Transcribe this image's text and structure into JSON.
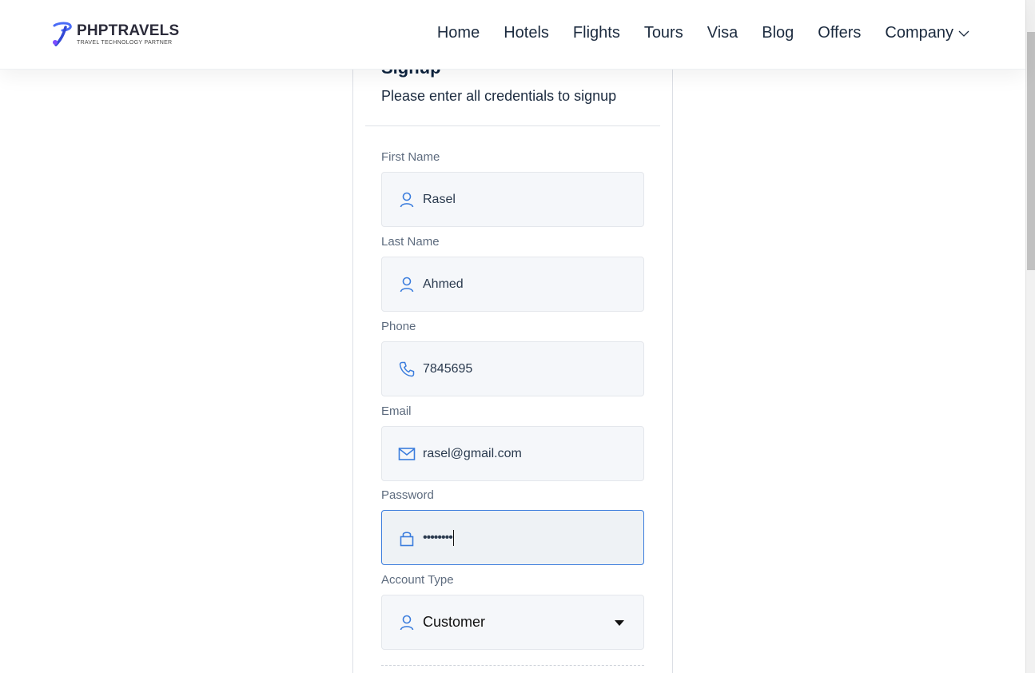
{
  "brand": {
    "name": "PHPTRAVELS",
    "tagline": "TRAVEL TECHNOLOGY PARTNER",
    "accent": "#3b7ddd"
  },
  "nav": {
    "items": [
      {
        "label": "Home"
      },
      {
        "label": "Hotels"
      },
      {
        "label": "Flights"
      },
      {
        "label": "Tours"
      },
      {
        "label": "Visa"
      },
      {
        "label": "Blog"
      },
      {
        "label": "Offers"
      },
      {
        "label": "Company",
        "icon": "chevron-down-icon"
      }
    ]
  },
  "signup": {
    "title": "Signup",
    "subtitle": "Please enter all credentials to signup",
    "fields": {
      "first_name": {
        "label": "First Name",
        "value": "Rasel",
        "icon": "user-icon"
      },
      "last_name": {
        "label": "Last Name",
        "value": "Ahmed",
        "icon": "user-icon"
      },
      "phone": {
        "label": "Phone",
        "value": "7845695",
        "icon": "phone-icon"
      },
      "email": {
        "label": "Email",
        "value": "rasel@gmail.com",
        "icon": "mail-icon"
      },
      "password": {
        "label": "Password",
        "value": "••••••••",
        "icon": "lock-icon"
      },
      "account_type": {
        "label": "Account Type",
        "value": "Customer",
        "icon": "user-icon"
      }
    }
  }
}
